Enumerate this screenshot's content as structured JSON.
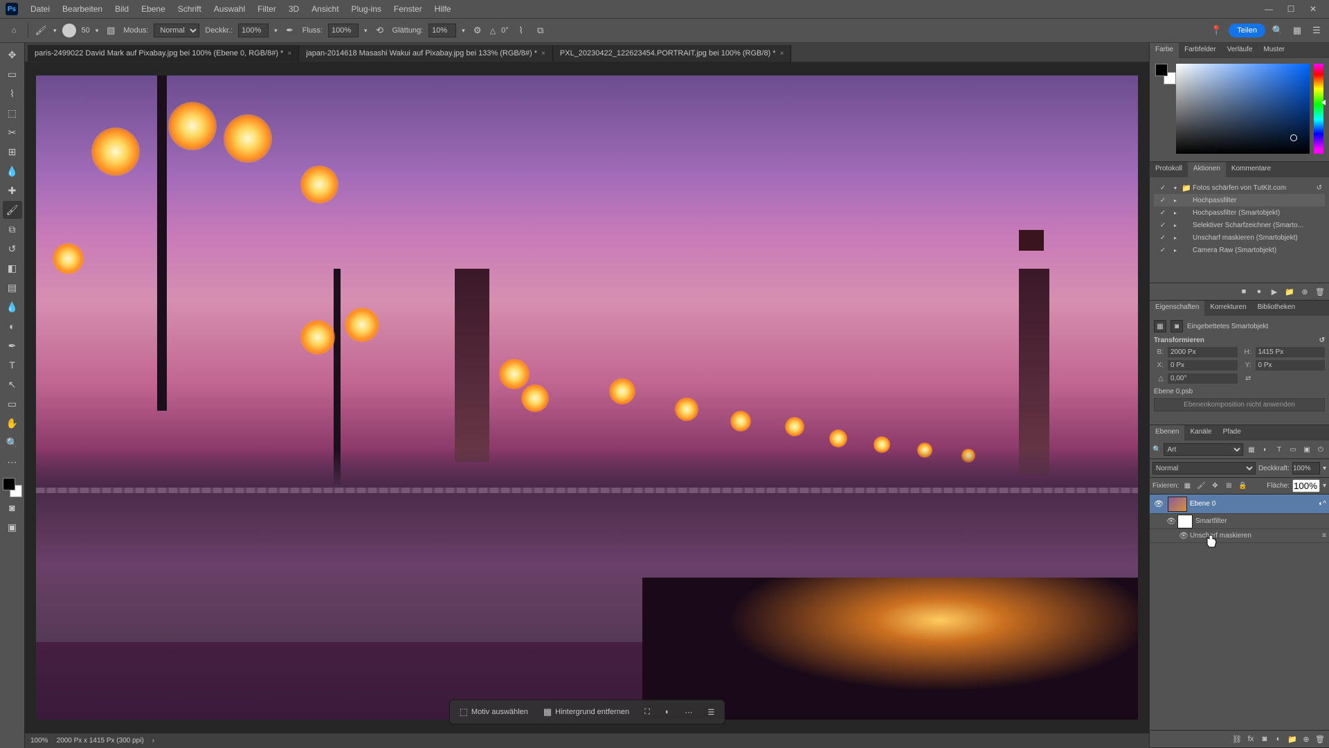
{
  "menu": [
    "Datei",
    "Bearbeiten",
    "Bild",
    "Ebene",
    "Schrift",
    "Auswahl",
    "Filter",
    "3D",
    "Ansicht",
    "Plug-ins",
    "Fenster",
    "Hilfe"
  ],
  "options": {
    "brush_size": "50",
    "mode_label": "Modus:",
    "mode_value": "Normal",
    "opacity_label": "Deckkr.:",
    "opacity_value": "100%",
    "flow_label": "Fluss:",
    "flow_value": "100%",
    "smoothing_label": "Glättung:",
    "smoothing_value": "10%",
    "angle_label": "△",
    "angle_value": "0°",
    "share": "Teilen"
  },
  "tabs": [
    {
      "title": "paris-2499022 David Mark auf Pixabay.jpg bei 100% (Ebene 0, RGB/8#) *",
      "active": true
    },
    {
      "title": "japan-2014618 Masashi Wakui auf Pixabay.jpg bei 133% (RGB/8#) *",
      "active": false
    },
    {
      "title": "PXL_20230422_122623454.PORTRAIT.jpg bei 100% (RGB/8) *",
      "active": false
    }
  ],
  "context_bar": {
    "select_subject": "Motiv auswählen",
    "remove_bg": "Hintergrund entfernen"
  },
  "status": {
    "zoom": "100%",
    "info": "2000 Px x 1415 Px (300 ppi)"
  },
  "panel_color": {
    "tabs": [
      "Farbe",
      "Farbfelder",
      "Verläufe",
      "Muster"
    ]
  },
  "panel_actions": {
    "tabs": [
      "Protokoll",
      "Aktionen",
      "Kommentare"
    ],
    "set_name": "Fotos schärfen von TutKit.com",
    "items": [
      "Hochpassfilter",
      "Hochpassfilter (Smartobjekt)",
      "Selektiver Scharfzeichner (Smarto...",
      "Unscharf maskieren (Smartobjekt)",
      "Camera Raw (Smartobjekt)"
    ]
  },
  "panel_props": {
    "tabs": [
      "Eigenschaften",
      "Korrekturen",
      "Bibliotheken"
    ],
    "type": "Eingebettetes Smartobjekt",
    "section_transform": "Transformieren",
    "w_label": "B:",
    "w_value": "2000 Px",
    "h_label": "H:",
    "h_value": "1415 Px",
    "x_label": "X:",
    "x_value": "0 Px",
    "y_label": "Y:",
    "y_value": "0 Px",
    "angle_value": "0,00°",
    "doc_name": "Ebene 0.psb",
    "comp_btn": "Ebenenkomposition nicht anwenden"
  },
  "panel_layers": {
    "tabs": [
      "Ebenen",
      "Kanäle",
      "Pfade"
    ],
    "filter_placeholder": "Art",
    "blend_mode": "Normal",
    "opacity_label": "Deckkraft:",
    "opacity_value": "100%",
    "lock_label": "Fixieren:",
    "fill_label": "Fläche:",
    "fill_value": "100%",
    "layer0": "Ebene 0",
    "smartfilter": "Smartfilter",
    "filter_name": "Unscharf maskieren"
  }
}
